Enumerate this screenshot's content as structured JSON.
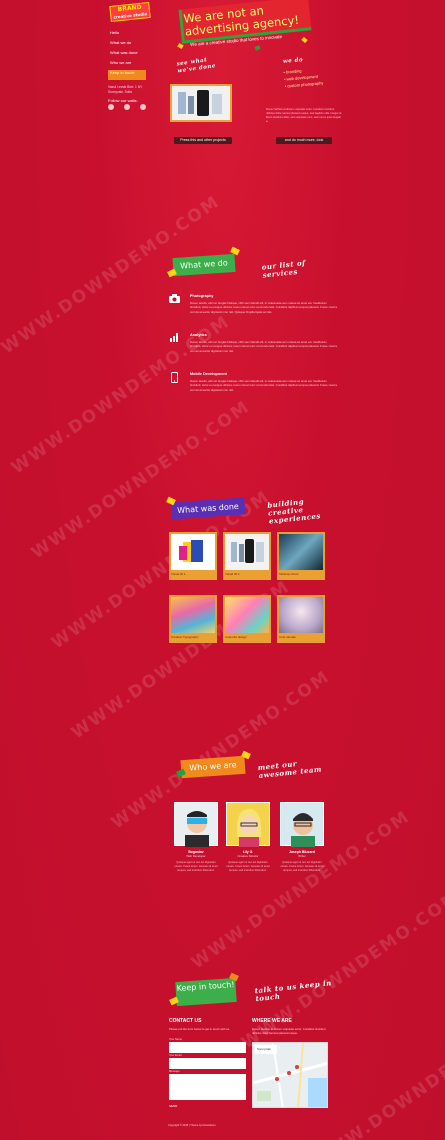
{
  "brand": {
    "logo_text": "BRAND",
    "logo_sub": "creative studio"
  },
  "nav": {
    "items": [
      {
        "label": "Hello",
        "active": false
      },
      {
        "label": "What we do",
        "active": false
      },
      {
        "label": "What was done",
        "active": false
      },
      {
        "label": "Who we are",
        "active": false
      },
      {
        "label": "Keep in touch",
        "active": true
      }
    ]
  },
  "sidebar": {
    "address": "Vassil Levski Blvd. 1 NY, Sunnyvale, Sofia",
    "follow_label": "Follow our walls:"
  },
  "hero": {
    "title": "We are not an advertising agency!",
    "subtitle": "We are a creative studio that loves to innovate",
    "see_what": "see what we've done",
    "we_do_label": "we do",
    "we_do_items": [
      "• branding",
      "• web development",
      "• custom photography"
    ],
    "description": "Donec facilisis at dictum vulputate tortor. Curabitur tincidunt ultricies dolor, laoreet placerat neque, sed sagittis nulla. Integer at libero tincidunt dolor, sed vulputate nunc, sed rutrum justo feugiat a.",
    "btn_projects": "Press this and other projects",
    "btn_more": "and do much more, look"
  },
  "services": {
    "tag": "What we do",
    "script": "our list of services",
    "items": [
      {
        "icon": "camera-icon",
        "title": "Photography",
        "text": "Donec iaculis, elit non feugiat tristique, nibh sem blandit elit, in malesuada sem massa sit amet est. Vestibulum tincidunt, tortor eu congue ultrices, lorem nisi at nunc commodo felis. Curabitur dapibus tempus placerat. Fusce viverra vel nisi at auctor dignissim non nisl. Quisque fringilla ligula vel nisi."
      },
      {
        "icon": "chart-icon",
        "title": "Analytics",
        "text": "Donec iaculis, elit non feugiat tristique, nibh sem blandit elit, in malesuada sem massa sit amet est. Vestibulum tincidunt, tortor eu congue ultrices, lorem nisi at nunc commodo felis. Curabitur dapibus tempus placerat. Fusce viverra vel nisi at auctor dignissim non nisl."
      },
      {
        "icon": "mobile-icon",
        "title": "Mobile Development",
        "text": "Donec iaculis, elit non feugiat tristique, nibh sem blandit elit, in malesuada sem massa sit amet est. Vestibulum tincidunt, tortor eu congue ultrices, lorem nisi at nunc commodo felis. Curabitur dapibus tempus placerat. Fusce viverra vel nisi at auctor dignissim non nisl."
      }
    ]
  },
  "work": {
    "tag": "What was done",
    "script": "building creative experiences",
    "items": [
      {
        "caption": "Visual ID 1"
      },
      {
        "caption": "Visual ID 2"
      },
      {
        "caption": "Tabletop shoot"
      },
      {
        "caption": "Creative Typography"
      },
      {
        "caption": "Colourful design"
      },
      {
        "caption": "Cute sample"
      }
    ]
  },
  "team": {
    "tag": "Who we are",
    "script": "meet our awesome team",
    "members": [
      {
        "name": "Bogoslav",
        "role": "Web Developer",
        "bio": "Quisque eget mi nec est dignissim ornare. Fusce lorem. Aenean sit amet tempus, sed interdum bibendum."
      },
      {
        "name": "Lily G.",
        "role": "Creative Director",
        "bio": "Quisque eget mi nec est dignissim ornare. Fusce lorem. Aenean sit amet tempus, sed interdum bibendum."
      },
      {
        "name": "Joseph Blizzard",
        "role": "Writer",
        "bio": "Quisque eget mi nec est dignissim ornare. Fusce lorem. Aenean sit amet tempus, sed interdum bibendum."
      }
    ]
  },
  "contact": {
    "tag": "Keep in touch!",
    "script": "talk to us keep in touch",
    "contact_title": "CONTACT US",
    "contact_intro": "Please put the form below to get in touch with us.",
    "label_name": "Your Name",
    "label_email": "Your Email",
    "label_message": "Message",
    "submit": "SEND",
    "where_title": "WHERE WE ARE",
    "where_text": "Donec facilisis at dictum vulputate tortor. Curabitur tincidunt ultricies dolor laoreet placerat neque.",
    "map_label": "Sunnyvale"
  },
  "footer": {
    "text": "Copyright © 2015 | Theme by Downdemo"
  },
  "watermark": "WWW.DOWNDEMO.COM"
}
